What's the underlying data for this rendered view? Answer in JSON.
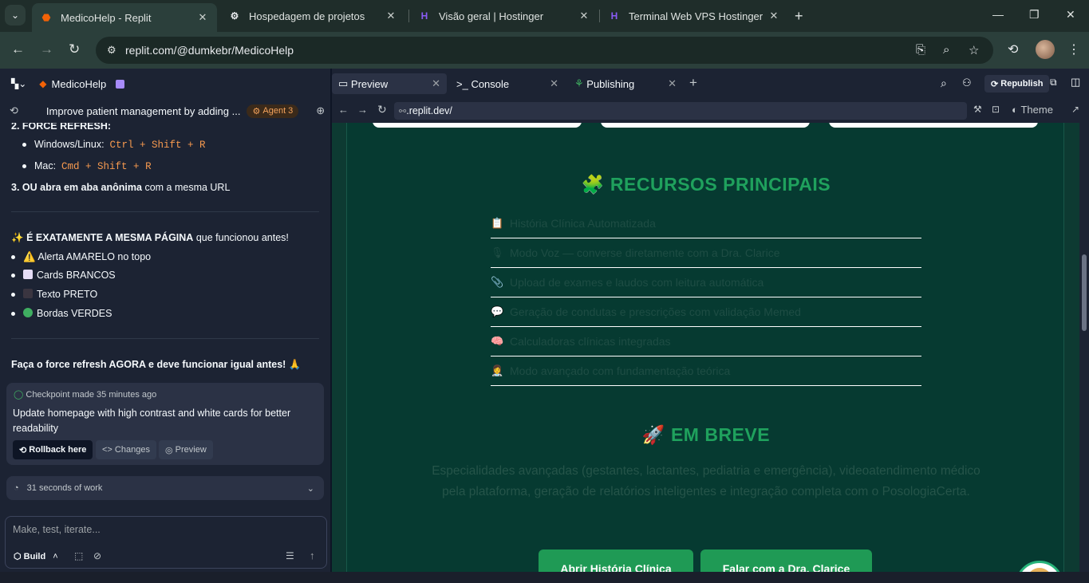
{
  "browser": {
    "tabs": [
      {
        "title": "MedicoHelp - Replit",
        "active": true,
        "icon": "replit-icon"
      },
      {
        "title": "Hospedagem de projetos",
        "active": false,
        "icon": "chatgpt-icon"
      },
      {
        "title": "Visão geral | Hostinger",
        "active": false,
        "icon": "hostinger-icon"
      },
      {
        "title": "Terminal Web VPS Hostinger",
        "active": false,
        "icon": "hostinger-icon"
      }
    ],
    "url": "replit.com/@dumkebr/MedicoHelp"
  },
  "replit": {
    "project_name": "MedicoHelp",
    "thread_title": "Improve patient management by adding ...",
    "agent_badge": "Agent 3",
    "chat": {
      "force_refresh_heading": "2. FORCE REFRESH:",
      "windows_label": "Windows/Linux:",
      "windows_keys": "Ctrl + Shift + R",
      "mac_label": "Mac:",
      "mac_keys": "Cmd + Shift + R",
      "step3_bold": "3. OU abra em aba anônima",
      "step3_rest": "com a mesma URL",
      "same_page_emoji": "✨",
      "same_page_bold": "É EXATAMENTE A MESMA PÁGINA",
      "same_page_rest": "que funcionou antes!",
      "items": [
        {
          "emoji": "⚠️",
          "text": "Alerta AMARELO no topo"
        },
        {
          "emoji": "white-square",
          "text": "Cards BRANCOS"
        },
        {
          "emoji": "black-square",
          "text": "Texto PRETO"
        },
        {
          "emoji": "green-circle",
          "text": "Bordas VERDES"
        }
      ],
      "final_message": "Faça o force refresh AGORA e deve funcionar igual antes! 🙏"
    },
    "checkpoint": {
      "label": "Checkpoint made 35 minutes ago",
      "description": "Update homepage with high contrast and white cards for better readability",
      "rollback": "Rollback here",
      "changes": "Changes",
      "preview": "Preview"
    },
    "work_summary": "31 seconds of work",
    "input_placeholder": "Make, test, iterate...",
    "mode_label": "Build"
  },
  "preview_pane": {
    "tabs": [
      "Preview",
      "Console",
      "Publishing"
    ],
    "republish": "Republish",
    "url": ".replit.dev/",
    "theme": "Theme"
  },
  "site": {
    "features_title": "RECURSOS PRINCIPAIS",
    "features_title_emoji": "🧩",
    "features": [
      {
        "emoji": "📋",
        "text": "História Clínica Automatizada"
      },
      {
        "emoji": "🎙",
        "text": "Modo Voz — converse diretamente com a Dra. Clarice"
      },
      {
        "emoji": "📎",
        "text": "Upload de exames e laudos com leitura automática"
      },
      {
        "emoji": "💬",
        "text": "Geração de condutas e prescrições com validação Memed"
      },
      {
        "emoji": "🧠",
        "text": "Calculadoras clínicas integradas"
      },
      {
        "emoji": "👩‍⚕️",
        "text": "Modo avançado com fundamentação teórica"
      }
    ],
    "soon_title": "EM BREVE",
    "soon_emoji": "🚀",
    "soon_text": "Especialidades avançadas (gestantes, lactantes, pediatria e emergência), videoatendimento médico pela plataforma, geração de relatórios inteligentes e integração completa com o PosologiaCerta.",
    "cta_primary": "Abrir História Clínica",
    "cta_secondary": "Falar com a Dra. Clarice"
  },
  "colors": {
    "site_bg": "#063a31",
    "accent_green": "#1fa15d",
    "replit_panel": "#1c2333",
    "badge_orange": "#f5a35c"
  }
}
